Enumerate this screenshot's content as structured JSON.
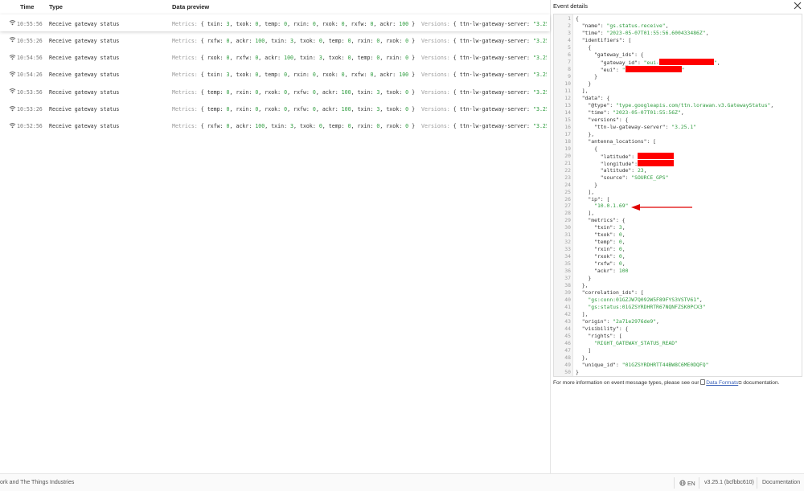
{
  "table": {
    "headers": {
      "time": "Time",
      "type": "Type",
      "preview": "Data preview"
    },
    "rows": [
      {
        "time": "10:55:56",
        "type": "Receive gateway status",
        "metrics": [
          [
            "txin",
            "3"
          ],
          [
            "txok",
            "0"
          ],
          [
            "temp",
            "0"
          ],
          [
            "rxin",
            "0"
          ],
          [
            "rxok",
            "0"
          ],
          [
            "rxfw",
            "0"
          ],
          [
            "ackr",
            "100"
          ]
        ],
        "version": "\"3.25.1\""
      },
      {
        "time": "10:55:26",
        "type": "Receive gateway status",
        "metrics": [
          [
            "rxfw",
            "0"
          ],
          [
            "ackr",
            "100"
          ],
          [
            "txin",
            "3"
          ],
          [
            "txok",
            "0"
          ],
          [
            "temp",
            "0"
          ],
          [
            "rxin",
            "0"
          ],
          [
            "rxok",
            "0"
          ]
        ],
        "version": "\"3.25.1\""
      },
      {
        "time": "10:54:56",
        "type": "Receive gateway status",
        "metrics": [
          [
            "rxok",
            "0"
          ],
          [
            "rxfw",
            "0"
          ],
          [
            "ackr",
            "100"
          ],
          [
            "txin",
            "3"
          ],
          [
            "txok",
            "0"
          ],
          [
            "temp",
            "0"
          ],
          [
            "rxin",
            "0"
          ]
        ],
        "version": "\"3.25.1\""
      },
      {
        "time": "10:54:26",
        "type": "Receive gateway status",
        "metrics": [
          [
            "txin",
            "3"
          ],
          [
            "txok",
            "0"
          ],
          [
            "temp",
            "0"
          ],
          [
            "rxin",
            "0"
          ],
          [
            "rxok",
            "0"
          ],
          [
            "rxfw",
            "0"
          ],
          [
            "ackr",
            "100"
          ]
        ],
        "version": "\"3.25.1\""
      },
      {
        "time": "10:53:56",
        "type": "Receive gateway status",
        "metrics": [
          [
            "temp",
            "0"
          ],
          [
            "rxin",
            "0"
          ],
          [
            "rxok",
            "0"
          ],
          [
            "rxfw",
            "0"
          ],
          [
            "ackr",
            "100"
          ],
          [
            "txin",
            "3"
          ],
          [
            "txok",
            "0"
          ]
        ],
        "version": "\"3.25.1\""
      },
      {
        "time": "10:53:26",
        "type": "Receive gateway status",
        "metrics": [
          [
            "temp",
            "0"
          ],
          [
            "rxin",
            "0"
          ],
          [
            "rxok",
            "0"
          ],
          [
            "rxfw",
            "0"
          ],
          [
            "ackr",
            "100"
          ],
          [
            "txin",
            "3"
          ],
          [
            "txok",
            "0"
          ]
        ],
        "version": "\"3.25.1\""
      },
      {
        "time": "10:52:56",
        "type": "Receive gateway status",
        "metrics": [
          [
            "rxfw",
            "0"
          ],
          [
            "ackr",
            "100"
          ],
          [
            "txin",
            "3"
          ],
          [
            "txok",
            "0"
          ],
          [
            "temp",
            "0"
          ],
          [
            "rxin",
            "0"
          ],
          [
            "rxok",
            "0"
          ]
        ],
        "version": "\"3.25.1\""
      }
    ],
    "labels": {
      "metrics": "Metrics:",
      "versions": "Versions:",
      "server_key": "ttn-lw-gateway-server:"
    }
  },
  "panel": {
    "title": "Event details",
    "json_lines": [
      "{",
      "  \"name\": \"gs.status.receive\",",
      "  \"time\": \"2023-05-07T01:55:56.600433486Z\",",
      "  \"identifiers\": [",
      "    {",
      "      \"gateway_ids\": {",
      "        \"gateway_id\": \"eui-[R]\",",
      "        \"eui\": \"[R]\"",
      "      }",
      "    }",
      "  ],",
      "  \"data\": {",
      "    \"@type\": \"type.googleapis.com/ttn.lorawan.v3.GatewayStatus\",",
      "    \"time\": \"2023-05-07T01:55:56Z\",",
      "    \"versions\": {",
      "      \"ttn-lw-gateway-server\": \"3.25.1\"",
      "    },",
      "    \"antenna_locations\": [",
      "      {",
      "        \"latitude\": [R]",
      "        \"longitude\":[R]",
      "        \"altitude\": 23,",
      "        \"source\": \"SOURCE_GPS\"",
      "      }",
      "    ],",
      "    \"ip\": [",
      "      \"10.0.1.69\"",
      "    ],",
      "    \"metrics\": {",
      "      \"txin\": 3,",
      "      \"txok\": 0,",
      "      \"temp\": 0,",
      "      \"rxin\": 0,",
      "      \"rxok\": 0,",
      "      \"rxfw\": 0,",
      "      \"ackr\": 100",
      "    }",
      "  },",
      "  \"correlation_ids\": [",
      "    \"gs:conn:01GZJW7Q092W5F89FYS3VSTV61\",",
      "    \"gs:status:01GZSYRDHRTR67NQNFZSK0PCX3\"",
      "  ],",
      "  \"origin\": \"2a71e2976de9\",",
      "  \"visibility\": {",
      "    \"rights\": [",
      "      \"RIGHT_GATEWAY_STATUS_READ\"",
      "    ]",
      "  },",
      "  \"unique_id\": \"01GZSYRDHRTT44BW8C6ME0DQFQ\"",
      "}"
    ],
    "footnote_pre": "For more information on event message types, please see our",
    "footnote_link": "Data Formats",
    "footnote_post": "documentation."
  },
  "footer": {
    "copyright": "ork and The Things Industries",
    "language": "EN",
    "version": "v3.25.1 (bcfbbc610)",
    "docs": "Documentation"
  },
  "colors": {
    "highlight": "#ff0000",
    "value_green": "#2e9c3e",
    "link": "#3b62b8"
  }
}
